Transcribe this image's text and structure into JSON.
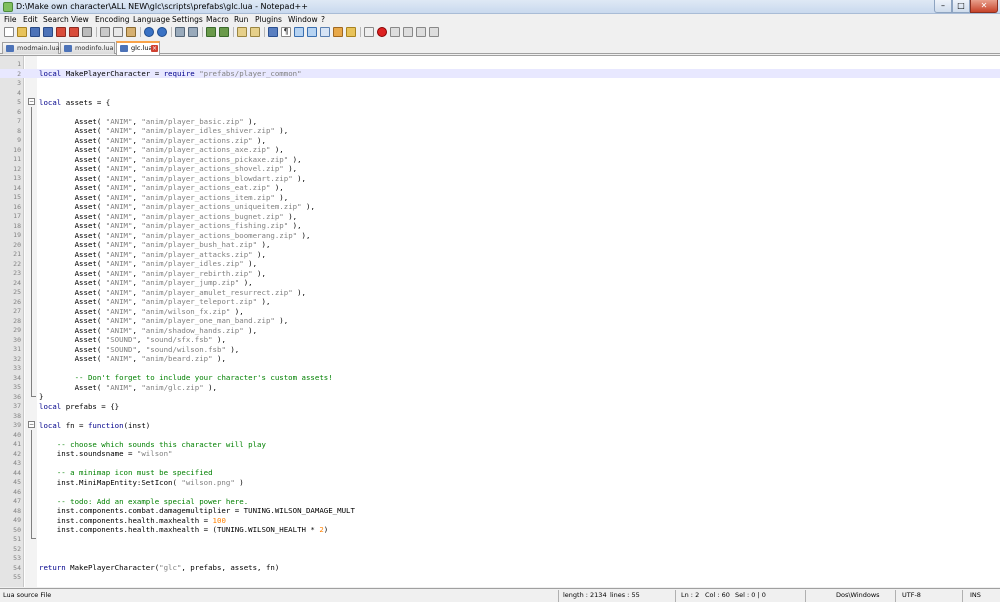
{
  "window": {
    "title": "D:\\Make own character\\ALL NEW\\glc\\scripts\\prefabs\\glc.lua - Notepad++",
    "minimize": "–",
    "maximize": "□",
    "close": "✕"
  },
  "menu": [
    "File",
    "Edit",
    "Search",
    "View",
    "Encoding",
    "Language",
    "Settings",
    "Macro",
    "Run",
    "Plugins",
    "Window",
    "?"
  ],
  "tabs": [
    {
      "label": "modmain.lua",
      "active": false
    },
    {
      "label": "modinfo.lua",
      "active": false
    },
    {
      "label": "glc.lua",
      "active": true
    }
  ],
  "colors": {
    "keyword": "#00008b",
    "string": "#808080",
    "comment": "#008000",
    "number": "#ff8000",
    "current_line": "#e8e8ff",
    "active_tab_accent": "#f9a34a"
  },
  "icons": [
    "new-file-icon",
    "open-file-icon",
    "save-icon",
    "save-all-icon",
    "close-icon",
    "close-all-icon",
    "print-icon",
    "cut-icon",
    "copy-icon",
    "paste-icon",
    "undo-icon",
    "redo-icon",
    "find-icon",
    "replace-icon",
    "zoom-in-icon",
    "zoom-out-icon",
    "sync-v-icon",
    "sync-h-icon",
    "word-wrap-icon",
    "show-all-chars-icon",
    "indent-guide-icon",
    "udl-icon",
    "doc-map-icon",
    "function-list-icon",
    "folder-workspace-icon",
    "monitor-icon",
    "record-macro-icon",
    "stop-record-icon",
    "play-macro-icon",
    "play-multiple-icon",
    "save-macro-icon"
  ],
  "code_lines": [
    "",
    "local MakePlayerCharacter = require \"prefabs/player_common\"",
    "",
    "",
    "local assets = {",
    "",
    "        Asset( \"ANIM\", \"anim/player_basic.zip\" ),",
    "        Asset( \"ANIM\", \"anim/player_idles_shiver.zip\" ),",
    "        Asset( \"ANIM\", \"anim/player_actions.zip\" ),",
    "        Asset( \"ANIM\", \"anim/player_actions_axe.zip\" ),",
    "        Asset( \"ANIM\", \"anim/player_actions_pickaxe.zip\" ),",
    "        Asset( \"ANIM\", \"anim/player_actions_shovel.zip\" ),",
    "        Asset( \"ANIM\", \"anim/player_actions_blowdart.zip\" ),",
    "        Asset( \"ANIM\", \"anim/player_actions_eat.zip\" ),",
    "        Asset( \"ANIM\", \"anim/player_actions_item.zip\" ),",
    "        Asset( \"ANIM\", \"anim/player_actions_uniqueitem.zip\" ),",
    "        Asset( \"ANIM\", \"anim/player_actions_bugnet.zip\" ),",
    "        Asset( \"ANIM\", \"anim/player_actions_fishing.zip\" ),",
    "        Asset( \"ANIM\", \"anim/player_actions_boomerang.zip\" ),",
    "        Asset( \"ANIM\", \"anim/player_bush_hat.zip\" ),",
    "        Asset( \"ANIM\", \"anim/player_attacks.zip\" ),",
    "        Asset( \"ANIM\", \"anim/player_idles.zip\" ),",
    "        Asset( \"ANIM\", \"anim/player_rebirth.zip\" ),",
    "        Asset( \"ANIM\", \"anim/player_jump.zip\" ),",
    "        Asset( \"ANIM\", \"anim/player_amulet_resurrect.zip\" ),",
    "        Asset( \"ANIM\", \"anim/player_teleport.zip\" ),",
    "        Asset( \"ANIM\", \"anim/wilson_fx.zip\" ),",
    "        Asset( \"ANIM\", \"anim/player_one_man_band.zip\" ),",
    "        Asset( \"ANIM\", \"anim/shadow_hands.zip\" ),",
    "        Asset( \"SOUND\", \"sound/sfx.fsb\" ),",
    "        Asset( \"SOUND\", \"sound/wilson.fsb\" ),",
    "        Asset( \"ANIM\", \"anim/beard.zip\" ),",
    "",
    "        -- Don't forget to include your character's custom assets!",
    "        Asset( \"ANIM\", \"anim/glc.zip\" ),",
    "}",
    "local prefabs = {}",
    "",
    "local fn = function(inst)",
    "",
    "    -- choose which sounds this character will play",
    "    inst.soundsname = \"wilson\"",
    "",
    "    -- a minimap icon must be specified",
    "    inst.MiniMapEntity:SetIcon( \"wilson.png\" )",
    "",
    "    -- todo: Add an example special power here.",
    "    inst.components.combat.damagemultiplier = TUNING.WILSON_DAMAGE_MULT",
    "    inst.components.health.maxhealth = 100",
    "    inst.components.health.maxhealth = (TUNING.WILSON_HEALTH * 2)",
    "",
    "",
    "",
    "return MakePlayerCharacter(\"glc\", prefabs, assets, fn)",
    ""
  ],
  "current_line": 2,
  "status": {
    "file_type": "Lua source File",
    "length": "length : 2134",
    "lines": "lines : 55",
    "ln": "Ln : 2",
    "col": "Col : 60",
    "sel": "Sel : 0 | 0",
    "eol": "Dos\\Windows",
    "encoding": "UTF-8",
    "mode": "INS"
  }
}
